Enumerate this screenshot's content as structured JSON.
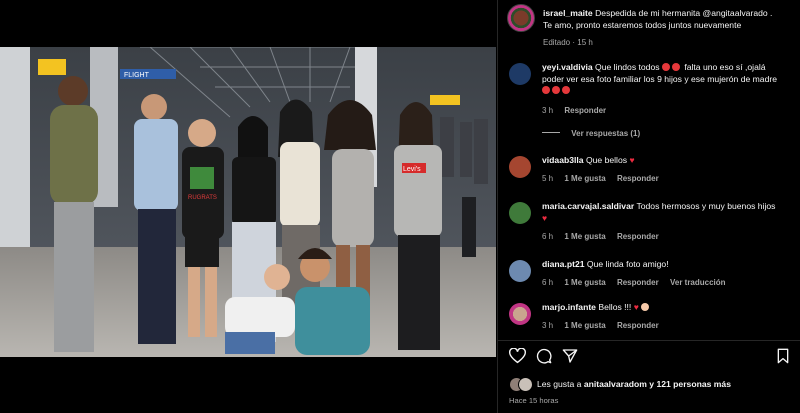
{
  "post": {
    "author": "israel_maite",
    "caption_line1": "Despedida de mi hermanita @angitaalvarado .",
    "caption_line2": "Te amo, pronto estaremos todos juntos nuevamente",
    "edited": "Editado · 15 h"
  },
  "comments": [
    {
      "user": "yeyi.valdivia",
      "line1": "Que lindos todos",
      "line1_tail": "falta uno eso sí ,ojalá",
      "line2": "poder ver esa foto familiar los 9 hijos y ese mujerón de madre",
      "time": "3 h",
      "reply": "Responder",
      "view_replies": "Ver respuestas (1)"
    },
    {
      "user": "vidaab3lla",
      "text": "Que bellos",
      "time": "5 h",
      "likes": "1 Me gusta",
      "reply": "Responder"
    },
    {
      "user": "maria.carvajal.saldivar",
      "text": "Todos hermosos y muy buenos hijos",
      "time": "6 h",
      "likes": "1 Me gusta",
      "reply": "Responder"
    },
    {
      "user": "diana.pt21",
      "text": "Que linda foto amigo!",
      "time": "6 h",
      "likes": "1 Me gusta",
      "reply": "Responder",
      "translate": "Ver traducción"
    },
    {
      "user": "marjo.infante",
      "text": "Bellos !!!",
      "time": "3 h",
      "likes": "1 Me gusta",
      "reply": "Responder"
    }
  ],
  "likes_summary": {
    "prefix": "Les gusta a",
    "user": "anitaalvaradom",
    "suffix": "y 121 personas más"
  },
  "posted_time": "Hace 15 horas",
  "photo": {
    "sign_left": "FLIGHT",
    "shirt_levis": "Levi's",
    "shirt_rugrats": "RUGRATS"
  },
  "colors": {
    "background": "#000000",
    "text": "#f5f5f5",
    "muted": "#a8a8a8",
    "like_red": "#ed2b40"
  }
}
